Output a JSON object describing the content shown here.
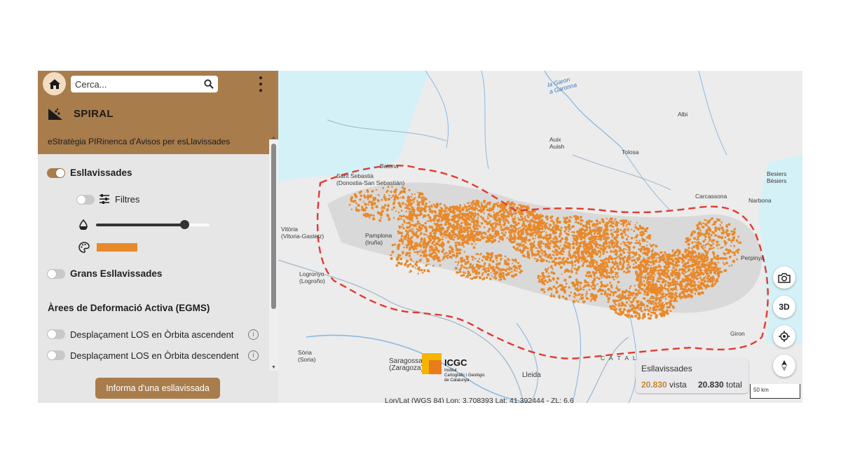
{
  "topbar": {
    "search_placeholder": "Cerca..."
  },
  "header": {
    "title": "SPIRAL",
    "subtitle": "eStratègia PIRinenca d'Avisos per esLlavissades"
  },
  "layers": {
    "esllavissades": {
      "label": "Esllavissades",
      "enabled": true
    },
    "filtres": {
      "label": "Filtres",
      "enabled": false
    },
    "opacity": 0.78,
    "color": "#e8892b",
    "grans": {
      "label": "Grans Esllavissades",
      "enabled": false
    }
  },
  "egms": {
    "title": "Àrees de Deformació Activa (EGMS)",
    "ascendent": "Desplaçament LOS en Òrbita ascendent",
    "descendent": "Desplaçament LOS en Òrbita descendent"
  },
  "report_button": "Informa d'una esllavissada",
  "map": {
    "places": {
      "garonne": "la Garon\na Garonna",
      "albi": "Albi",
      "auix": "Auix\nAuish",
      "tolosa": "Tolosa",
      "besiers": "Besiers\nBésiers",
      "baiona": "Baiona",
      "sant_sebastia": "Sant Sebastià\n(Donostia-San Sebastián)",
      "carcassona": "Carcassona",
      "narbona": "Narbona",
      "vitoria": "Vitòria\n(Vitoria-Gasteiz)",
      "pamplona": "Pamplona\n(Iruña)",
      "perpinya": "Perpinyà",
      "logronyo": "Logronyo\n(Logroño)",
      "soria": "Sòria\n(Soria)",
      "saragossa": "Saragossa\n(Zaragoza)",
      "lleida": "Lleida",
      "girona": "Giron",
      "catalunya": "C A T A L"
    },
    "controls": {
      "three_d": "3D"
    },
    "legend": {
      "title": "Esllavissades",
      "visible_count": "20.830",
      "visible_label": "vista",
      "total_count": "20.830",
      "total_label": "total"
    },
    "scale": "50 km",
    "coords": "Lon/Lat (WGS 84) Lon: 3.708393 Lat: 41.392444 - ZL: 6.6",
    "logo": {
      "name": "ICGC",
      "subtitle": "Institut\nCartogràfic i Geològic\nde Catalunya"
    }
  }
}
